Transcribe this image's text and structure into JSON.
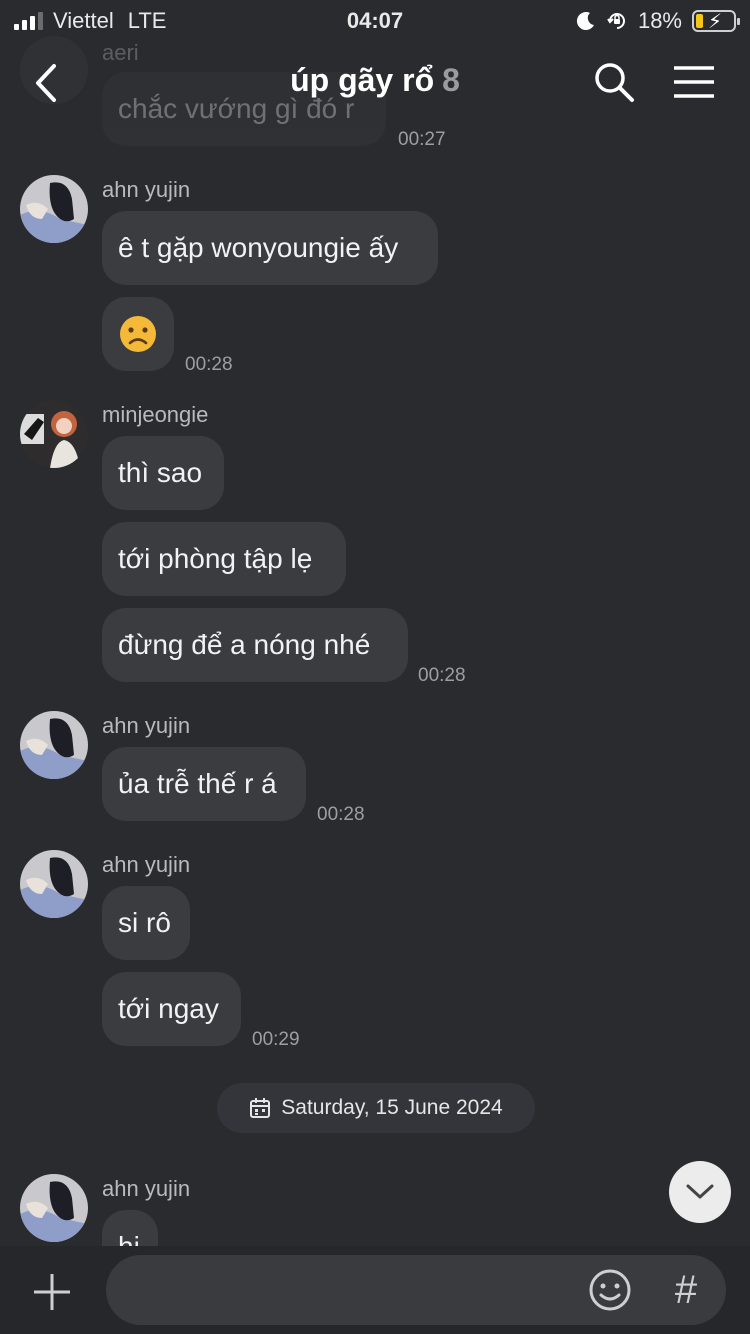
{
  "status_bar": {
    "carrier": "Viettel",
    "network": "LTE",
    "time": "04:07",
    "battery": "18%"
  },
  "header": {
    "title": "úp gãy rổ",
    "member_count": "8"
  },
  "messages": [
    {
      "sender": "aeri",
      "text": "chắc vướng gì đó r",
      "time": "00:27"
    },
    {
      "sender": "ahn yujin",
      "texts": [
        "ê t gặp wonyoungie ấy",
        "😦"
      ],
      "time": "00:28"
    },
    {
      "sender": "minjeongie",
      "texts": [
        "thì sao",
        "tới phòng tập lẹ",
        "đừng để a nóng nhé"
      ],
      "time": "00:28"
    },
    {
      "sender": "ahn yujin",
      "texts": [
        "ủa trễ thế r á"
      ],
      "time": "00:28"
    },
    {
      "sender": "ahn yujin",
      "texts": [
        "si rô",
        "tới ngay"
      ],
      "time": "00:29"
    },
    {
      "sender": "ahn yujin",
      "texts": [
        "hi"
      ]
    }
  ],
  "date_divider": "Saturday, 15 June 2024",
  "composer": {
    "placeholder": ""
  },
  "colors": {
    "background": "#2a2b2f",
    "bubble": "#3b3c40",
    "battery_fill": "#f5c518"
  },
  "icons": [
    "back-arrow-icon",
    "search-icon",
    "menu-icon",
    "calendar-icon",
    "chevron-down-icon",
    "plus-icon",
    "emoji-icon",
    "hashtag-icon",
    "moon-icon",
    "rotation-lock-icon",
    "charging-icon"
  ]
}
